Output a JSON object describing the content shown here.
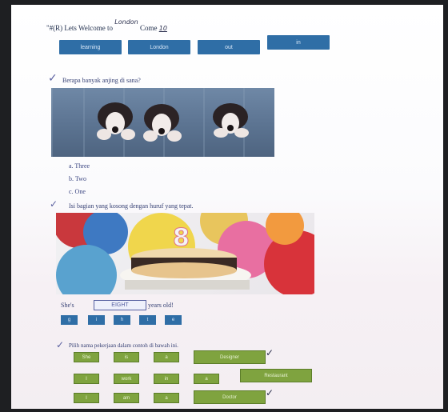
{
  "header": {
    "prefix": "\"#(R) Lets Welcome to",
    "handwritten": "London",
    "suffix": "Come",
    "handwritten_number": "10"
  },
  "tabs": [
    {
      "label": "learning"
    },
    {
      "label": "London"
    },
    {
      "label": "out"
    },
    {
      "label": "in"
    }
  ],
  "question1": {
    "text": "Berapa banyak anjing di sana?",
    "options": [
      "a. Three",
      "b. Two",
      "c. One"
    ]
  },
  "question2": {
    "text": "Isi bagian yang kosong dengan huruf yang tepat.",
    "cake_number": "8",
    "sentence_prefix": "She's",
    "sentence_blank": "EIGHT",
    "sentence_suffix": "years old!",
    "letters": [
      "g",
      "i",
      "h",
      "t",
      "e"
    ]
  },
  "question3": {
    "text": "Pilih nama pekerjaan dalam contoh di bawah ini.",
    "row1": [
      "She",
      "is",
      "a",
      "Designer"
    ],
    "row2": [
      "I",
      "work",
      "in",
      "a",
      "Restaurant"
    ],
    "row3": [
      "I",
      "am",
      "a",
      "Doctor"
    ]
  },
  "colors": {
    "tab_blue": "#2f6ea6",
    "word_green": "#7fa33f",
    "ink_blue": "#343f73"
  }
}
